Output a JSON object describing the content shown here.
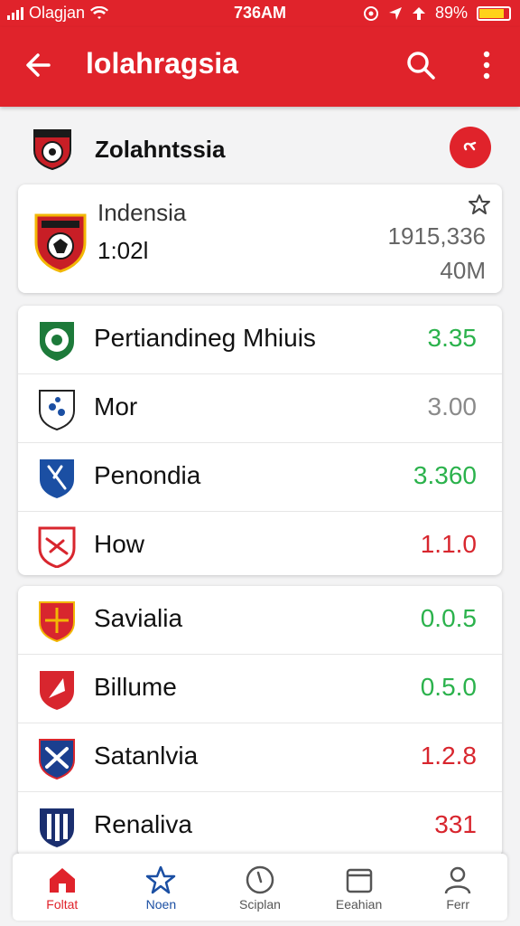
{
  "status": {
    "carrier": "Olagjan",
    "time": "736AM",
    "battery": "89%",
    "colors": {
      "bar": "#e0232b",
      "battery": "#ffd21a"
    }
  },
  "appbar": {
    "title": "lolahragsia",
    "icons": [
      "arrow-left-icon",
      "search-icon",
      "more-vert-icon"
    ]
  },
  "section": {
    "name": "Zolahntssia",
    "fab_icon": "share-icon"
  },
  "featured": {
    "name": "Indensia",
    "score": "1:02l",
    "value1": "1915,336",
    "value2": "40M"
  },
  "list1": [
    {
      "label": "Pertiandineg Mhiuis",
      "value": "3.35",
      "color": "#2bb24c"
    },
    {
      "label": "Mor",
      "value": "3.00",
      "color": "#8a8a8a"
    },
    {
      "label": "Penondia",
      "value": "3.360",
      "color": "#2bb24c"
    },
    {
      "label": "How",
      "value": "1.1.0",
      "color": "#d8262e"
    }
  ],
  "list2": [
    {
      "label": "Savialia",
      "value": "0.0.5",
      "color": "#2bb24c"
    },
    {
      "label": "Billume",
      "value": "0.5.0",
      "color": "#2bb24c"
    },
    {
      "label": "Satanlvia",
      "value": "1.2.8",
      "color": "#d8262e"
    },
    {
      "label": "Renaliva",
      "value": "331",
      "color": "#d8262e"
    }
  ],
  "nav": [
    {
      "label": "Foltat",
      "icon": "home-icon",
      "color": "#e0232b"
    },
    {
      "label": "Noen",
      "icon": "star-icon",
      "color": "#1b4fa3"
    },
    {
      "label": "Sciplan",
      "icon": "clock-icon",
      "color": "#555555"
    },
    {
      "label": "Eeahian",
      "icon": "calendar-icon",
      "color": "#555555"
    },
    {
      "label": "Ferr",
      "icon": "user-icon",
      "color": "#555555"
    }
  ]
}
